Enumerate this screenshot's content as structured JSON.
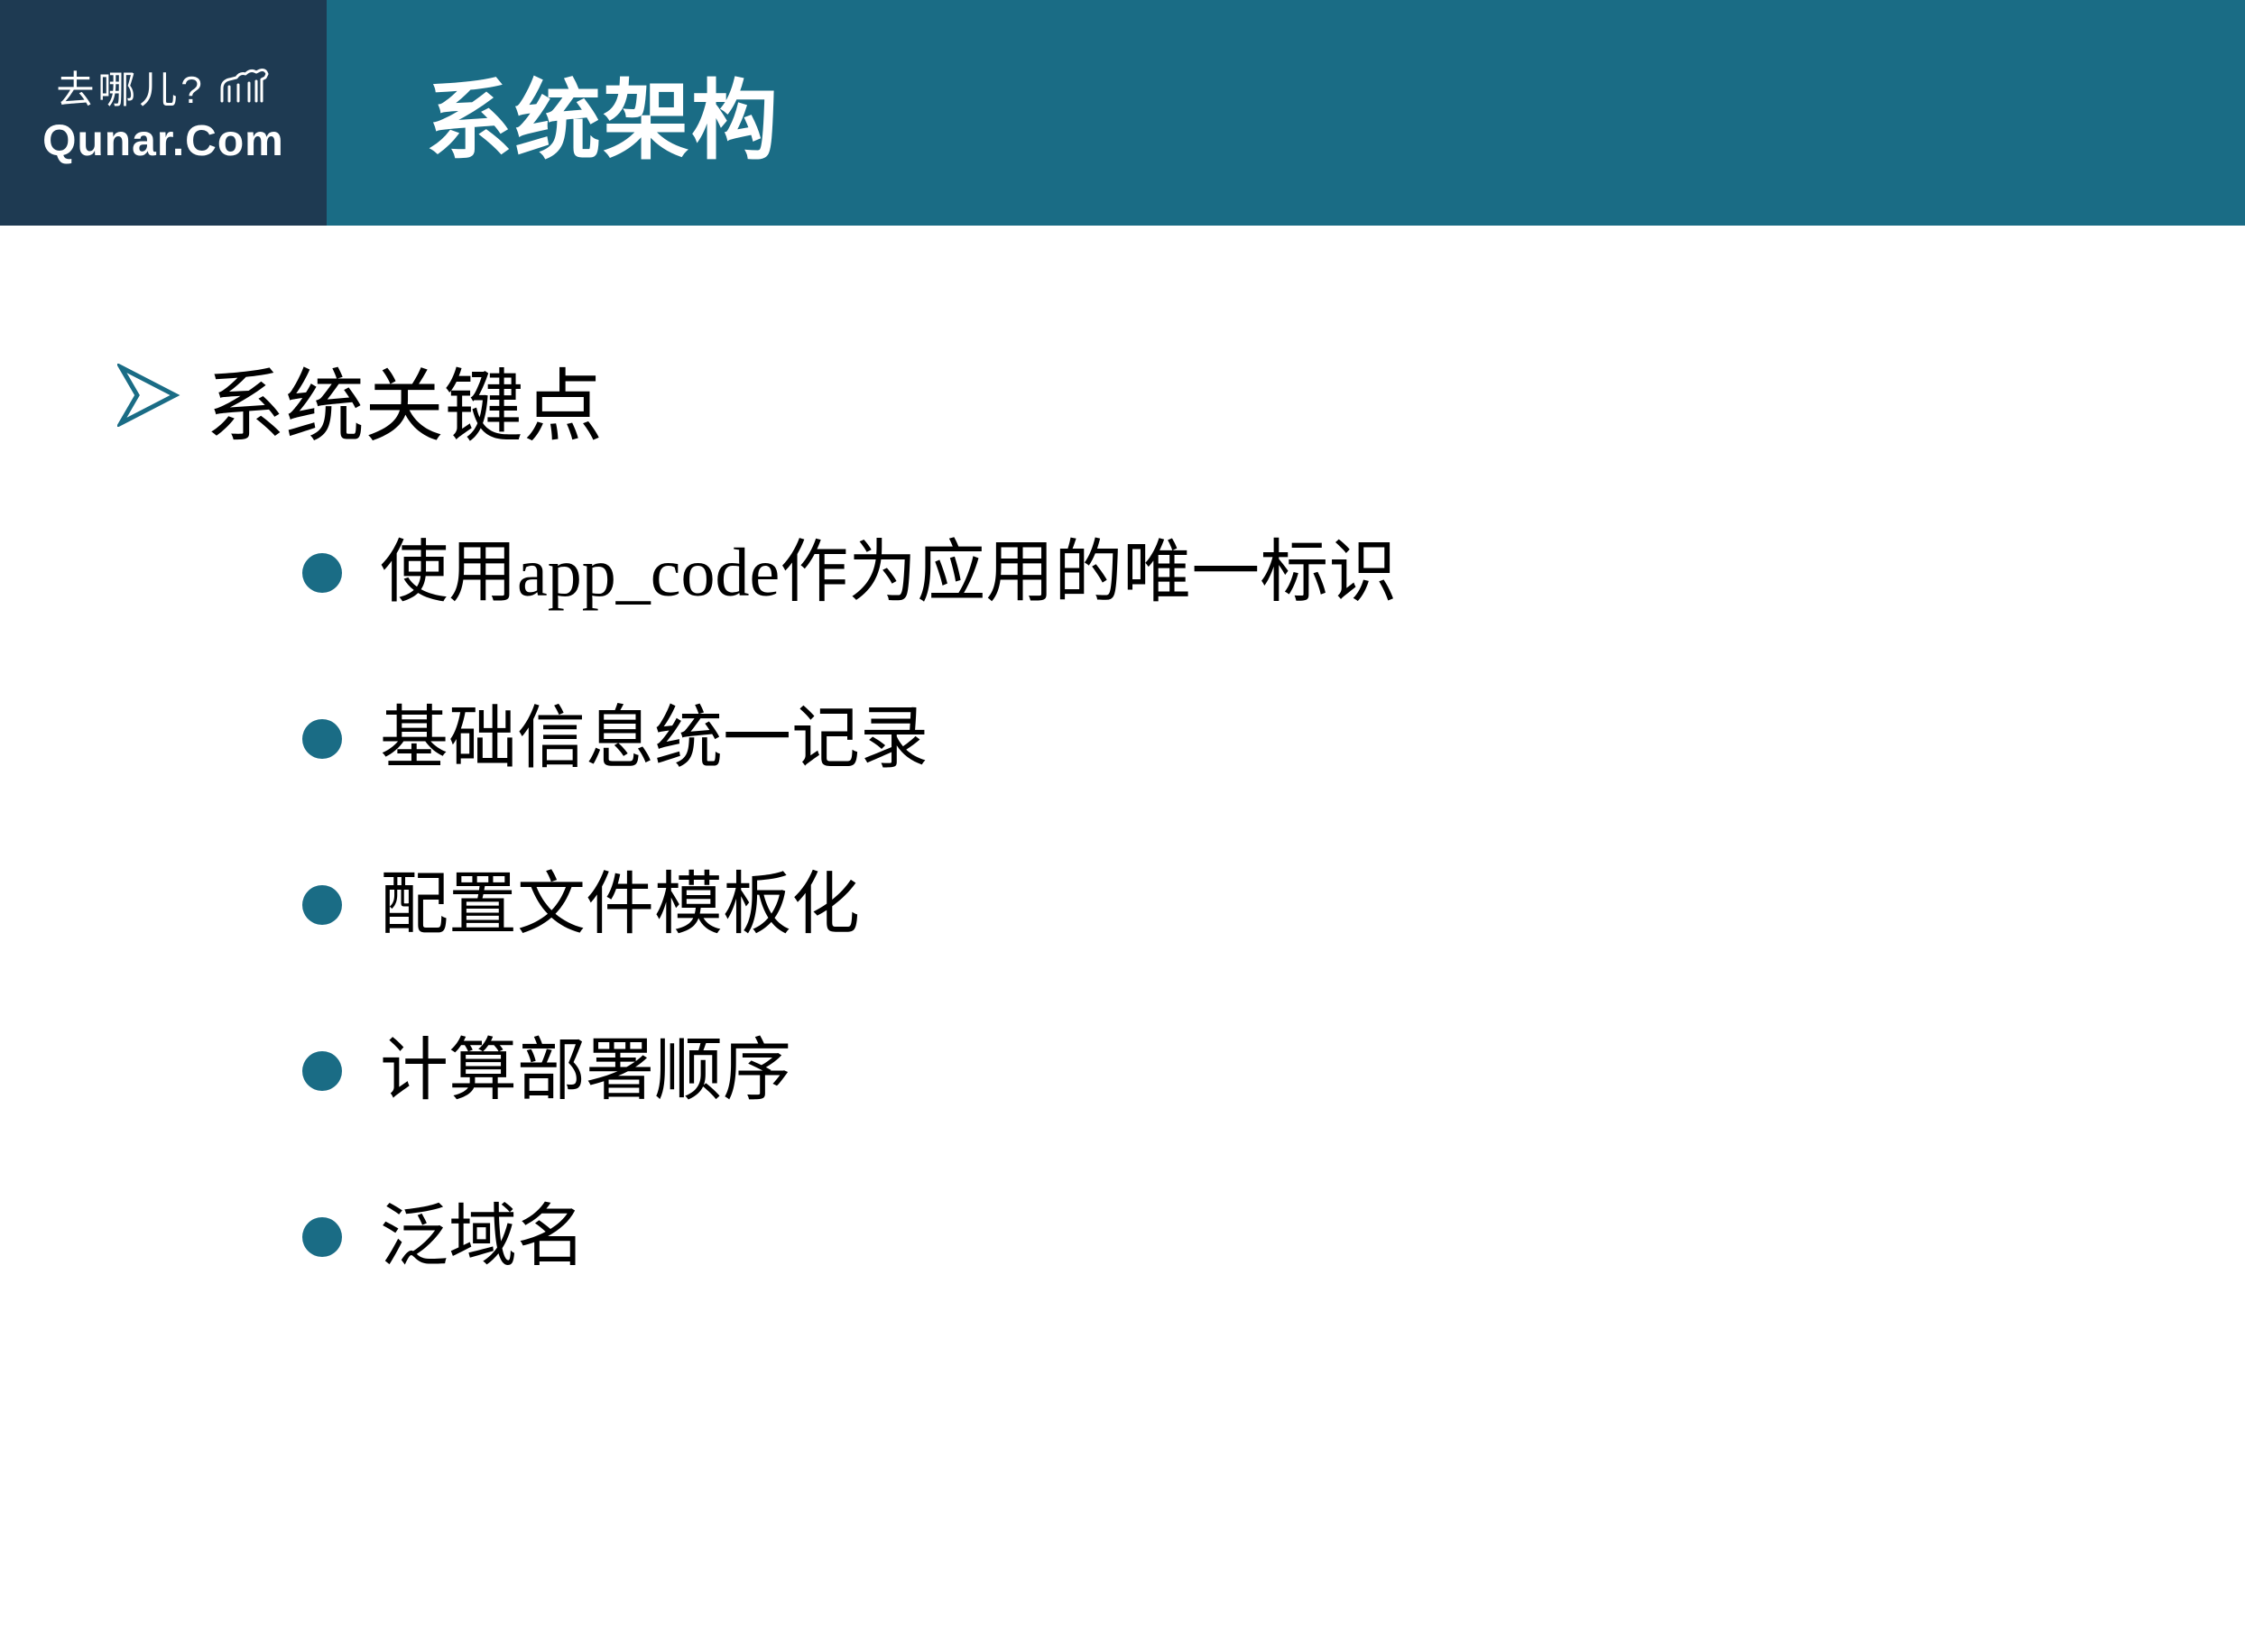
{
  "header": {
    "logo_line1": "去哪儿?",
    "logo_line2": "Qunar.Com",
    "title": "系统架构"
  },
  "content": {
    "heading": "系统关键点",
    "bullets": [
      "使用app_code作为应用的唯一标识",
      "基础信息统一记录",
      "配置文件模板化",
      "计算部署顺序",
      "泛域名"
    ]
  }
}
